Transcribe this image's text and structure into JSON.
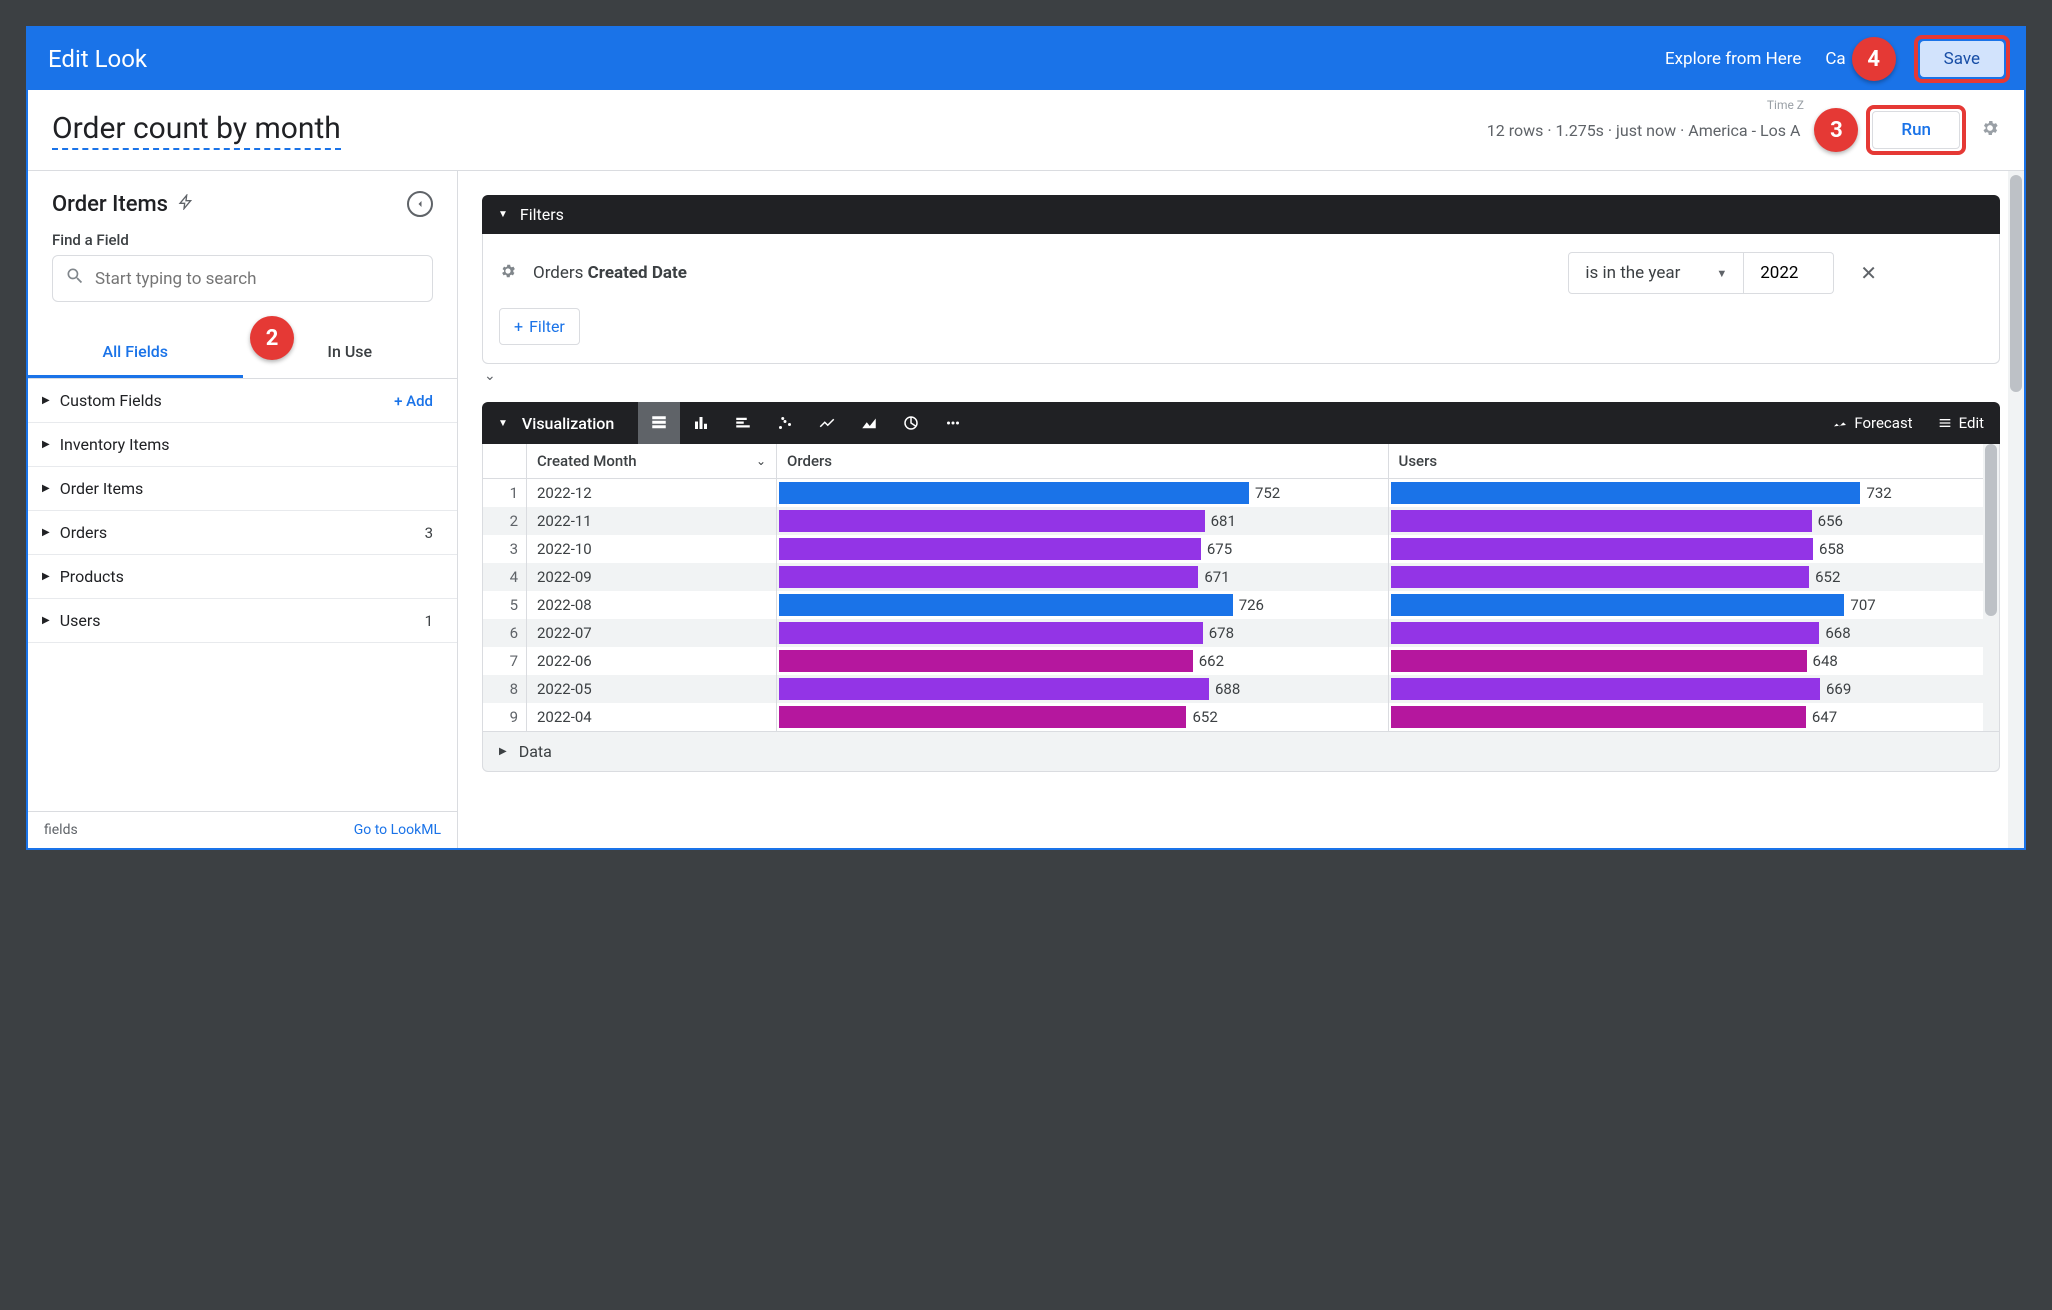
{
  "topbar": {
    "title": "Edit Look",
    "explore": "Explore from Here",
    "cancel": "Ca",
    "save": "Save"
  },
  "look": {
    "title": "Order count by month",
    "meta": "12 rows · 1.275s · just now · America - Los A",
    "meta_label": "Time Z",
    "run": "Run"
  },
  "sidebar": {
    "explore": "Order Items",
    "find_label": "Find a Field",
    "search_placeholder": "Start typing to search",
    "tab_all": "All Fields",
    "tab_inuse": "In Use",
    "add_label": "+  Add",
    "categories": [
      {
        "label": "Custom Fields",
        "right": "add"
      },
      {
        "label": "Inventory Items",
        "right": ""
      },
      {
        "label": "Order Items",
        "right": ""
      },
      {
        "label": "Orders",
        "right": "3"
      },
      {
        "label": "Products",
        "right": ""
      },
      {
        "label": "Users",
        "right": "1"
      }
    ],
    "footer_left": "fields",
    "footer_right": "Go to LookML"
  },
  "filters": {
    "header": "Filters",
    "field": "Orders",
    "field_bold": "Created Date",
    "operator": "is in the year",
    "value": "2022",
    "add_filter": "Filter"
  },
  "viz": {
    "header": "Visualization",
    "forecast": "Forecast",
    "edit": "Edit",
    "col_month": "Created Month",
    "col_orders": "Orders",
    "col_users": "Users"
  },
  "data_section": "Data",
  "chart_data": {
    "type": "table",
    "columns": [
      "Created Month",
      "Orders",
      "Users"
    ],
    "rows": [
      {
        "idx": 1,
        "month": "2022-12",
        "orders": 752,
        "users": 732,
        "color": "blue"
      },
      {
        "idx": 2,
        "month": "2022-11",
        "orders": 681,
        "users": 656,
        "color": "purple"
      },
      {
        "idx": 3,
        "month": "2022-10",
        "orders": 675,
        "users": 658,
        "color": "purple"
      },
      {
        "idx": 4,
        "month": "2022-09",
        "orders": 671,
        "users": 652,
        "color": "purple"
      },
      {
        "idx": 5,
        "month": "2022-08",
        "orders": 726,
        "users": 707,
        "color": "blue"
      },
      {
        "idx": 6,
        "month": "2022-07",
        "orders": 678,
        "users": 668,
        "color": "purple"
      },
      {
        "idx": 7,
        "month": "2022-06",
        "orders": 662,
        "users": 648,
        "color": "magenta"
      },
      {
        "idx": 8,
        "month": "2022-05",
        "orders": 688,
        "users": 669,
        "color": "purple"
      },
      {
        "idx": 9,
        "month": "2022-04",
        "orders": 652,
        "users": 647,
        "color": "magenta"
      }
    ],
    "orders_max": 752,
    "users_max": 732
  },
  "callouts": {
    "c2": "2",
    "c3": "3",
    "c4": "4"
  }
}
